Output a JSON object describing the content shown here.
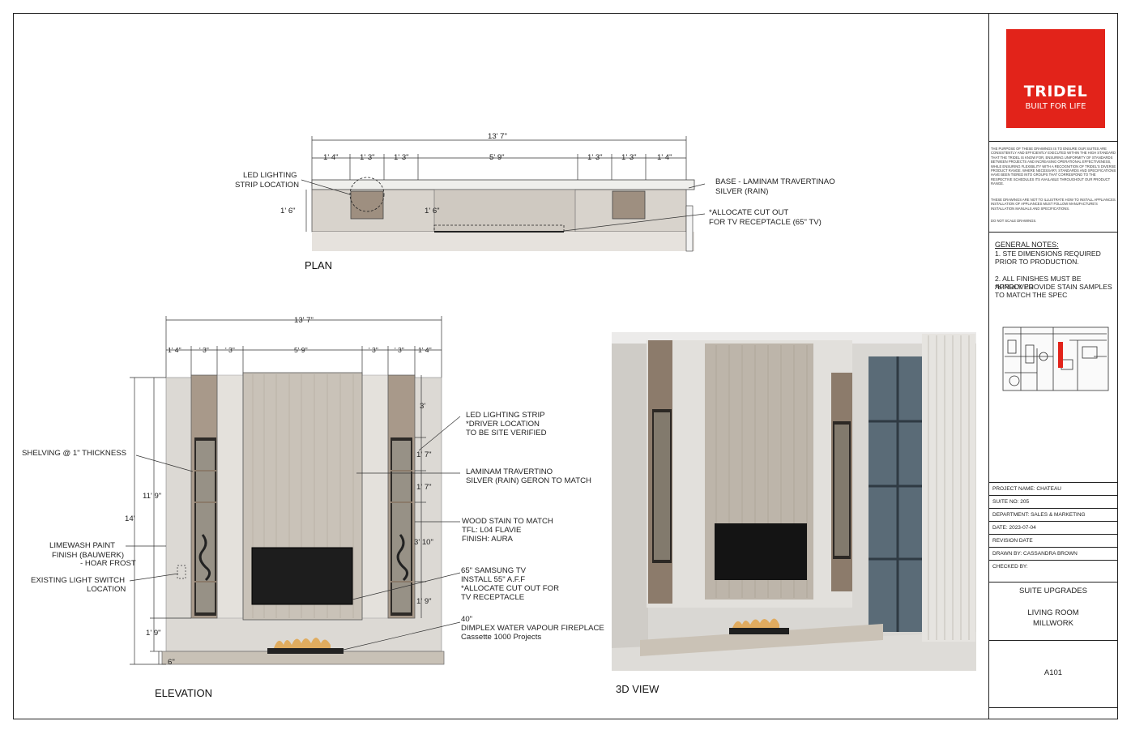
{
  "logo": {
    "brand": "TRIDEL",
    "tagline": "BUILT FOR LIFE"
  },
  "disclaimer": {
    "p1": "THE PURPOSE OF THESE DRAWINGS IS TO ENSURE OUR SUITES ARE CONSISTENTLY AND EFFICIENTLY EXECUTED WITHIN THE HIGH STANDARD THAT THE TRIDEL IS KNOW FOR, ENSURING UNIFORMITY OF STANDARDS BETWEEN PROJECTS AND INCREASING OPERATIONAL EFFECTIVENESS, WHILE ENSURING FLEXIBILITY WITH A RECOGNITION OF TRIDEL'S DIVERSE PRODUCT RANGE. WHERE NECESSARY, STANDARDS AND SPECIFICATIONS HAVE BEEN TIERED INTO GROUPS THAT CORRESPOND TO THE RESPECTIVE SCHEDULES ITS AVAILABLE THROUGHOUT OUR PRODUCT RANGE.",
    "p2": "THESE DRAWINGS ARE NOT TO ILLUSTRATE HOW TO INSTALL APPLIANCES. INSTALLATION OF APPLIANCES MUST FOLLOW MANUFACTURE'S INSTALLATION MANUALS AND SPECIFICATIONS.",
    "p3": "DO NOT SCALE DRAWINGS."
  },
  "general_notes": {
    "heading": "GENERAL NOTES:",
    "n1a": "1. STE DIMENSIONS REQUIRED",
    "n1b": "PRIOR TO PRODUCTION.",
    "n2a": "2. ALL FINISHES MUST BE APPROVED",
    "n2b": "*KINDLY PROVIDE STAIN SAMPLES",
    "n2c": "TO MATCH THE SPEC"
  },
  "title_block": {
    "project": "PROJECT NAME: CHATEAU",
    "suite": "SUITE NO: 205",
    "department": "DEPARTMENT: SALES & MARKETING",
    "date": "DATE: 2023-07-04",
    "revision": "REVISION DATE",
    "drawn_by": "DRAWN BY: CASSANDRA BROWN",
    "checked_by": "CHECKED BY:",
    "title1": "SUITE UPGRADES",
    "title2": "LIVING ROOM",
    "title3": "MILLWORK",
    "sheet": "A101"
  },
  "views": {
    "plan": "PLAN",
    "elevation": "ELEVATION",
    "view3d": "3D VIEW"
  },
  "plan": {
    "overall": "13' 7\"",
    "dims": [
      "1' 4\"",
      "1' 3\"",
      "1' 3\"",
      "5' 9\"",
      "1' 3\"",
      "1' 3\"",
      "1' 4\""
    ],
    "depth_left": "1' 6\"",
    "depth_inner": "1' 6\"",
    "led_1": "LED LIGHTING",
    "led_2": "STRIP LOCATION",
    "base_1": "BASE - LAMINAM TRAVERTINAO",
    "base_2": "SILVER (RAIN)",
    "cut_1": "*ALLOCATE CUT OUT",
    "cut_2": "FOR TV RECEPTACLE (65\" TV)"
  },
  "elevation": {
    "overall": "13' 7\"",
    "dims": [
      "1' 4\"",
      "' 3\"",
      "' 3\"",
      "5' 9\"",
      "' 3\"",
      "' 3\"",
      "1' 4\""
    ],
    "v_total": "14'",
    "v_unit": "11' 9\"",
    "v_base": "1' 9\"",
    "v_plinth": "6\"",
    "r_top": "3'",
    "r_shelf1": "1' 7\"",
    "r_shelf2": "1' 7\"",
    "r_shelf3": "3' 10\"",
    "r_bottom": "1' 9\"",
    "shelving": "SHELVING @ 1\" THICKNESS",
    "lime_1": "LIMEWASH PAINT",
    "lime_2": "FINISH (BAUWERK)",
    "lime_3": "- HOAR FROST",
    "switch_1": "EXISTING LIGHT SWITCH",
    "switch_2": "LOCATION",
    "ledstrip_1": "LED LIGHTING STRIP",
    "ledstrip_2": "*DRIVER LOCATION",
    "ledstrip_3": "TO BE SITE VERIFIED",
    "lam_1": "LAMINAM TRAVERTINO",
    "lam_2": "SILVER (RAIN) GERON TO MATCH",
    "wood_1": "WOOD STAIN TO MATCH",
    "wood_2": "TFL: L04 FLAVIE",
    "wood_3": "FINISH: AURA",
    "tv_1": "65\" SAMSUNG TV",
    "tv_2": "INSTALL 55\" A.F.F",
    "tv_3": "*ALLOCATE CUT OUT FOR",
    "tv_4": "TV RECEPTACLE",
    "fp_1": "40\"",
    "fp_2": "DIMPLEX WATER VAPOUR FIREPLACE",
    "fp_3": "Cassette 1000 Projects"
  }
}
